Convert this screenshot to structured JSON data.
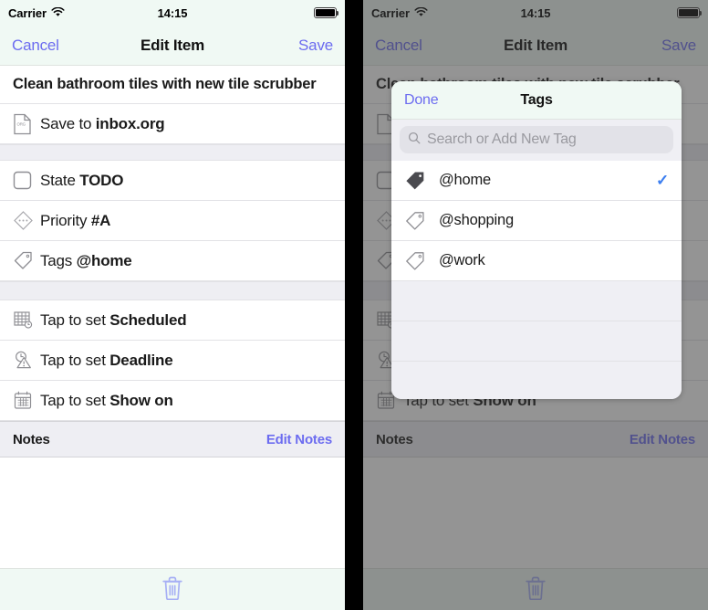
{
  "status_bar": {
    "carrier": "Carrier",
    "time": "14:15",
    "wifi_icon": "wifi-icon",
    "battery_icon": "battery-full-icon"
  },
  "nav": {
    "cancel": "Cancel",
    "title": "Edit Item",
    "save": "Save"
  },
  "item": {
    "title": "Clean bathroom tiles with new tile scrubber",
    "file_prefix": "Save to ",
    "file_value": "inbox.org",
    "state_prefix": "State ",
    "state_value": "TODO",
    "priority_prefix": "Priority ",
    "priority_value": "#A",
    "tags_prefix": "Tags ",
    "tags_value": "@home",
    "scheduled_prefix": "Tap to set ",
    "scheduled_value": "Scheduled",
    "deadline_prefix": "Tap to set ",
    "deadline_value": "Deadline",
    "showon_prefix": "Tap to set ",
    "showon_value": "Show on"
  },
  "notes": {
    "header": "Notes",
    "edit_link": "Edit Notes"
  },
  "toolbar": {
    "delete_icon": "trash-icon"
  },
  "tags_modal": {
    "done": "Done",
    "title": "Tags",
    "search_placeholder": "Search or Add New Tag",
    "search_value": "",
    "tags": [
      {
        "name": "@home",
        "selected": true,
        "checkmark": "✓"
      },
      {
        "name": "@shopping",
        "selected": false,
        "checkmark": ""
      },
      {
        "name": "@work",
        "selected": false,
        "checkmark": ""
      }
    ]
  },
  "colors": {
    "accent": "#6c6cf0",
    "checkmark": "#3b7ef0",
    "navbar_bg": "#f0f9f4",
    "section_bg": "#eeeef3",
    "gutter": "#000000"
  }
}
